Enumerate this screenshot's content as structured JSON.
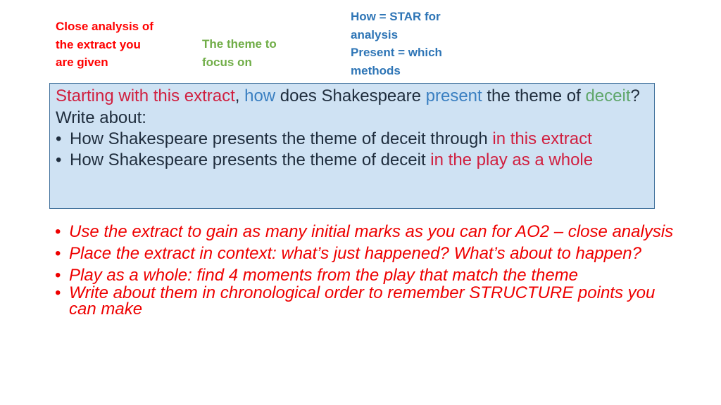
{
  "annotations": {
    "extract_note": [
      "Close analysis of",
      "the extract you",
      "are given"
    ],
    "theme_note": [
      "The theme to",
      "focus on"
    ],
    "method_note": [
      "How = STAR for",
      "analysis",
      "Present = which",
      "methods"
    ]
  },
  "question": {
    "line1": {
      "part1": "Starting with this extract",
      "part2": ", ",
      "part3": "how",
      "part4": " does Shakespeare ",
      "part5": "present",
      "part6": " the theme of ",
      "part7": "deceit",
      "part8": "?"
    },
    "write_about": "Write about:",
    "bullet_char": "•",
    "bullets": [
      {
        "plain": "How Shakespeare presents the theme of deceit through ",
        "highlight": "in this extract"
      },
      {
        "plain": "How Shakespeare presents the theme of deceit ",
        "highlight": "in the play as a whole"
      }
    ]
  },
  "tips": [
    "Use the extract to gain as many initial marks as you can for AO2 – close analysis",
    "Place the extract in context: what’s just happened? What’s about to happen?",
    "Play as a whole: find 4 moments from the play that match the theme",
    "Write about them in chronological order to remember STRUCTURE points you can make"
  ],
  "colors": {
    "red_label": "#ff0000",
    "green_label": "#70ad47",
    "blue_label": "#2e75b6",
    "box_fill": "#cfe2f3",
    "box_border": "#41719c"
  }
}
